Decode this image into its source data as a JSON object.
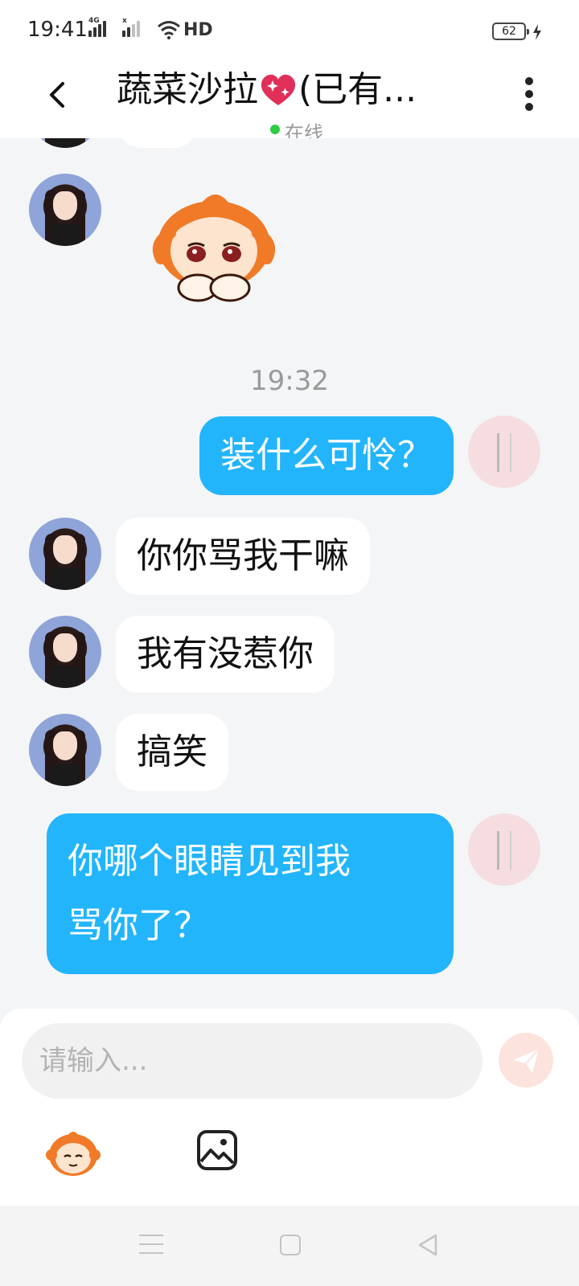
{
  "status_bar": {
    "time": "19:41",
    "network_1": "4G",
    "network_2": "x",
    "hd": "HD",
    "battery": "62"
  },
  "header": {
    "title_before_heart": "蔬菜沙拉",
    "title_after_heart": "(已有...",
    "status": "在线"
  },
  "messages": [
    {
      "side": "in",
      "kind": "sticker",
      "sticker": "crying-orange-character"
    },
    {
      "kind": "time",
      "text": "19:32"
    },
    {
      "side": "out",
      "text": "装什么可怜？"
    },
    {
      "side": "in",
      "text": "你你骂我干嘛"
    },
    {
      "side": "in",
      "text": "我有没惹你"
    },
    {
      "side": "in",
      "text": "搞笑"
    },
    {
      "side": "out",
      "lines": [
        "你哪个眼睛见到我",
        "骂你了？"
      ]
    }
  ],
  "input": {
    "placeholder": "请输入..."
  },
  "colors": {
    "outgoing_bubble": "#22b5fb",
    "incoming_bubble": "#ffffff",
    "background": "#f4f5f7",
    "online_dot": "#2ecc40",
    "send_button": "#fde3dd"
  },
  "icons": [
    "back-icon",
    "heart-icon",
    "more-icon",
    "emoji-icon",
    "image-icon",
    "send-icon"
  ]
}
